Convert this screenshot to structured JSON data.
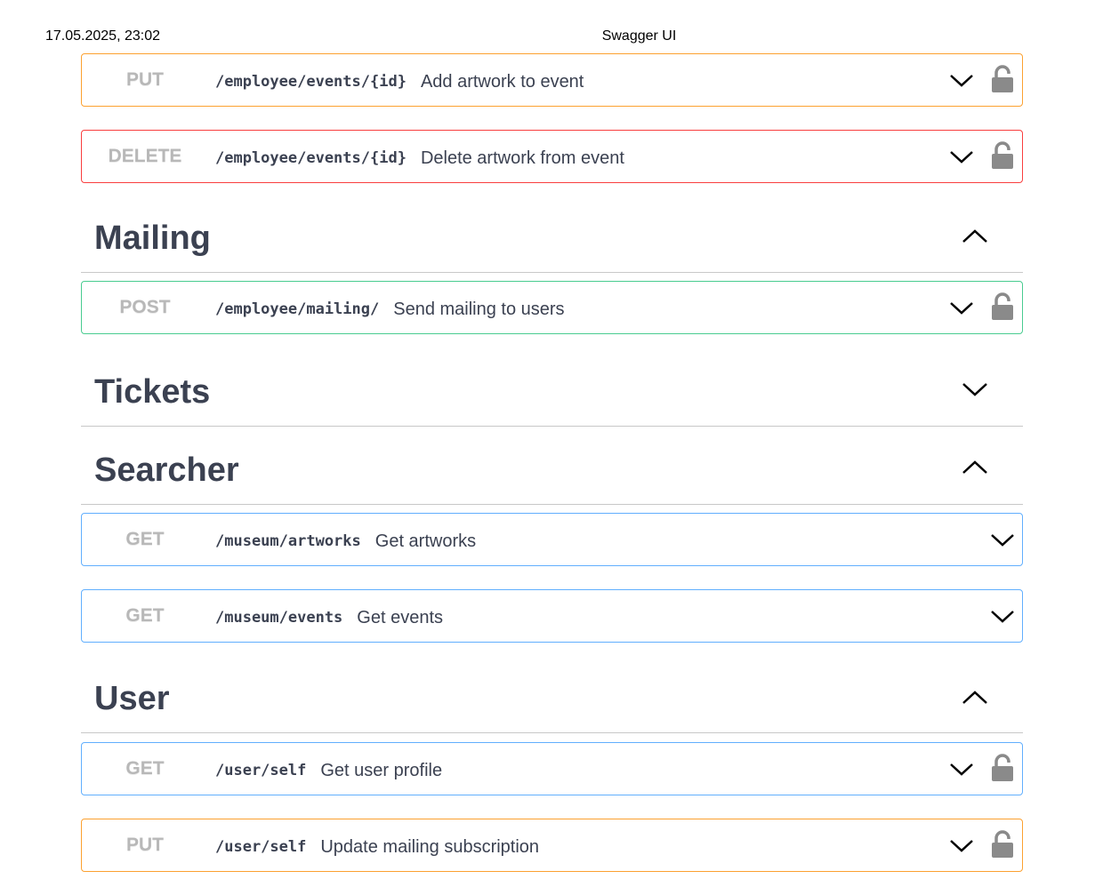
{
  "print_header": {
    "date": "17.05.2025, 23:02",
    "title": "Swagger UI"
  },
  "ops": {
    "put_event": {
      "method": "PUT",
      "path": "/employee/events/{id}",
      "summary": "Add artwork to event"
    },
    "delete_event": {
      "method": "DELETE",
      "path": "/employee/events/{id}",
      "summary": "Delete artwork from event"
    },
    "post_mailing": {
      "method": "POST",
      "path": "/employee/mailing/",
      "summary": "Send mailing to users"
    },
    "get_artworks": {
      "method": "GET",
      "path": "/museum/artworks",
      "summary": "Get artworks"
    },
    "get_events": {
      "method": "GET",
      "path": "/museum/events",
      "summary": "Get events"
    },
    "get_user_self": {
      "method": "GET",
      "path": "/user/self",
      "summary": "Get user profile"
    },
    "put_user_self": {
      "method": "PUT",
      "path": "/user/self",
      "summary": "Update mailing subscription"
    }
  },
  "tags": {
    "mailing": {
      "name": "Mailing",
      "expanded": true
    },
    "tickets": {
      "name": "Tickets",
      "expanded": false
    },
    "searcher": {
      "name": "Searcher",
      "expanded": true
    },
    "user": {
      "name": "User",
      "expanded": true
    }
  },
  "colors": {
    "put": "#fca130",
    "delete": "#f93e3e",
    "post": "#49cc90",
    "get": "#61affe",
    "method_text": "#b8b8b8",
    "lock": "#8a8a8a"
  },
  "icons": {
    "expand": "chevron-down-icon",
    "collapse": "chevron-up-icon",
    "auth": "lock-icon"
  }
}
